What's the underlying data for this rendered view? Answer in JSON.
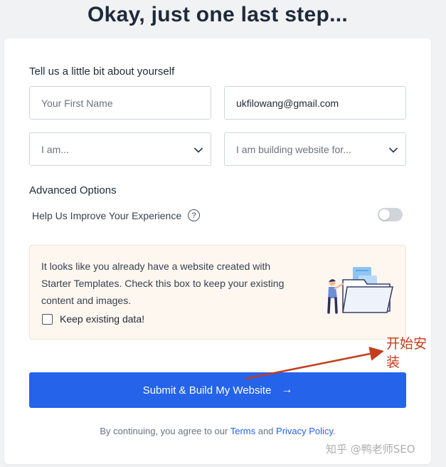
{
  "heading": "Okay, just one last step...",
  "about": {
    "title": "Tell us a little bit about yourself",
    "first_name_placeholder": "Your First Name",
    "email_value": "ukfilowang@gmail.com",
    "role_select": "I am...",
    "purpose_select": "I am building website for..."
  },
  "advanced": {
    "title": "Advanced Options",
    "help_label": "Help Us Improve Your Experience",
    "help_icon": "?",
    "toggle_on": false
  },
  "notice": {
    "text": "It looks like you already have a website created with Starter Templates. Check this box to keep your existing content and images.",
    "checkbox_label": "Keep existing data!",
    "checked": false
  },
  "submit": {
    "label": "Submit & Build My Website",
    "arrow": "→"
  },
  "legal": {
    "prefix": "By continuing, you agree to our ",
    "terms": "Terms",
    "and": " and ",
    "privacy": "Privacy Policy",
    "suffix": "."
  },
  "annotation": {
    "text": "开始安装",
    "color": "#c43d1d"
  },
  "watermark": "知乎 @鸭老师SEO",
  "colors": {
    "primary": "#2563eb",
    "notice_bg": "#fef7f0",
    "heading": "#1e2a3b"
  }
}
